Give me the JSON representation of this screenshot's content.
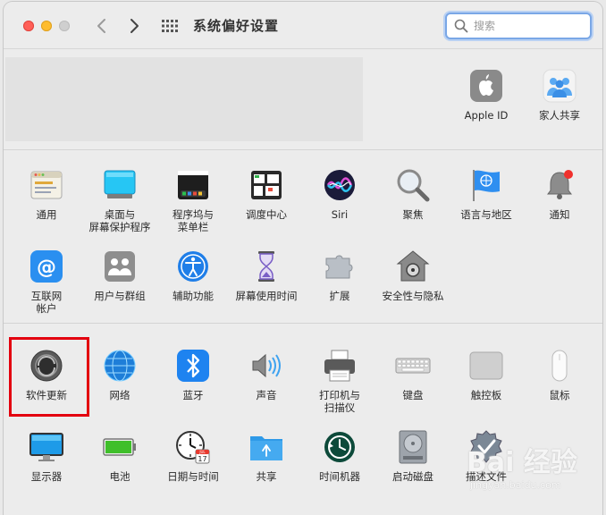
{
  "window": {
    "title": "系统偏好设置"
  },
  "search": {
    "placeholder": "搜索",
    "value": ""
  },
  "account": {
    "items": [
      {
        "label": "Apple ID",
        "icon": "apple-icon"
      },
      {
        "label": "家人共享",
        "icon": "family-sharing-icon"
      }
    ]
  },
  "section1": {
    "items": [
      {
        "label": "通用",
        "icon": "general-icon"
      },
      {
        "label": "桌面与\n屏幕保护程序",
        "icon": "desktop-screensaver-icon"
      },
      {
        "label": "程序坞与\n菜单栏",
        "icon": "dock-menubar-icon"
      },
      {
        "label": "调度中心",
        "icon": "mission-control-icon"
      },
      {
        "label": "Siri",
        "icon": "siri-icon"
      },
      {
        "label": "聚焦",
        "icon": "spotlight-icon"
      },
      {
        "label": "语言与地区",
        "icon": "language-region-icon"
      },
      {
        "label": "通知",
        "icon": "notifications-icon"
      },
      {
        "label": "互联网\n帐户",
        "icon": "internet-accounts-icon"
      },
      {
        "label": "用户与群组",
        "icon": "users-groups-icon"
      },
      {
        "label": "辅助功能",
        "icon": "accessibility-icon"
      },
      {
        "label": "屏幕使用时间",
        "icon": "screen-time-icon"
      },
      {
        "label": "扩展",
        "icon": "extensions-icon"
      },
      {
        "label": "安全性与隐私",
        "icon": "security-privacy-icon"
      }
    ]
  },
  "section2": {
    "items": [
      {
        "label": "软件更新",
        "icon": "software-update-icon"
      },
      {
        "label": "网络",
        "icon": "network-icon"
      },
      {
        "label": "蓝牙",
        "icon": "bluetooth-icon"
      },
      {
        "label": "声音",
        "icon": "sound-icon"
      },
      {
        "label": "打印机与\n扫描仪",
        "icon": "printers-scanners-icon"
      },
      {
        "label": "键盘",
        "icon": "keyboard-icon"
      },
      {
        "label": "触控板",
        "icon": "trackpad-icon"
      },
      {
        "label": "鼠标",
        "icon": "mouse-icon"
      },
      {
        "label": "显示器",
        "icon": "displays-icon"
      },
      {
        "label": "电池",
        "icon": "battery-icon"
      },
      {
        "label": "日期与时间",
        "icon": "date-time-icon"
      },
      {
        "label": "共享",
        "icon": "sharing-icon"
      },
      {
        "label": "时间机器",
        "icon": "time-machine-icon"
      },
      {
        "label": "启动磁盘",
        "icon": "startup-disk-icon"
      },
      {
        "label": "描述文件",
        "icon": "profiles-icon"
      }
    ]
  },
  "calendar_icon": {
    "month": "JUL",
    "day": "17"
  },
  "watermark": {
    "main": "Bai 经验",
    "sub": "jingyan.baidu.com"
  },
  "colors": {
    "highlight": "#e3000f",
    "search_focus": "#7aa7e6"
  }
}
